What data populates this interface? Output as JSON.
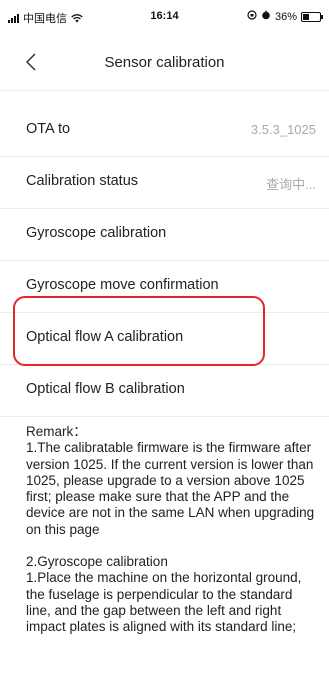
{
  "status_bar": {
    "carrier": "中国电信",
    "time": "16:14",
    "battery_percent": "36%",
    "battery_level": 0.36
  },
  "nav": {
    "title": "Sensor calibration",
    "back_icon": "chevron-left-icon"
  },
  "rows": [
    {
      "label": "OTA to",
      "value": "3.5.3_1025"
    },
    {
      "label": "Calibration status",
      "value": "查询中..."
    },
    {
      "label": "Gyroscope calibration",
      "value": ""
    },
    {
      "label": "Gyroscope move confirmation",
      "value": ""
    },
    {
      "label": "Optical flow A calibration",
      "value": ""
    },
    {
      "label": "Optical flow B calibration",
      "value": ""
    }
  ],
  "highlight_color": "#e3262d",
  "remark": {
    "title": "Remark：",
    "paragraph1": "1.The calibratable firmware is the firmware after version 1025. If the current version is lower than 1025, please upgrade to a version above 1025 first; please make sure that the APP and the device are not in the same LAN when upgrading on this page",
    "section2_title": "2.Gyroscope calibration",
    "section2_step1": "1.Place the machine on the horizontal ground, the fuselage is perpendicular to the standard line, and the gap between the left and right impact plates is aligned with its standard line;"
  }
}
